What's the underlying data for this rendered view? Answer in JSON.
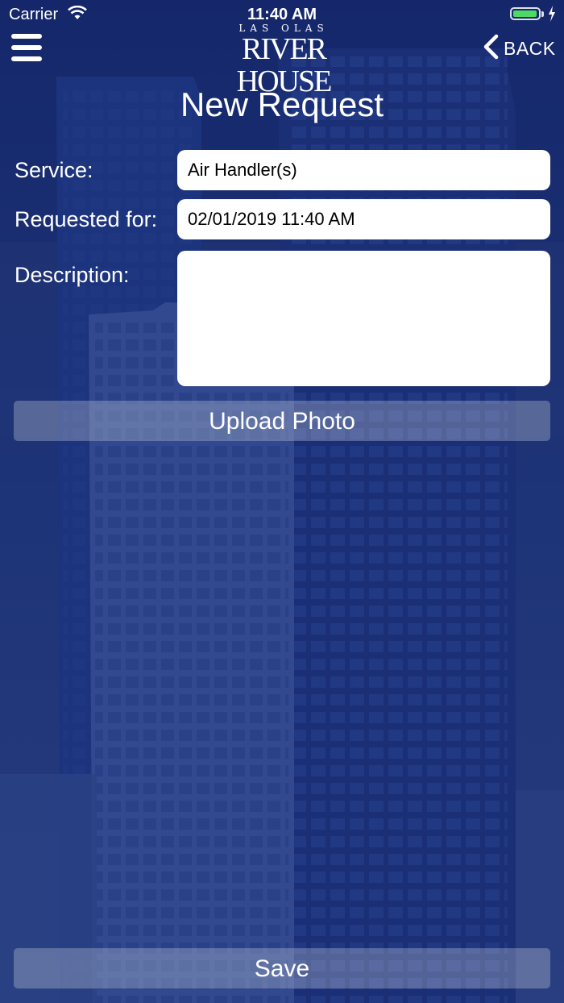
{
  "status_bar": {
    "carrier": "Carrier",
    "time": "11:40 AM",
    "battery_level": 0.95,
    "battery_color": "#4cd964"
  },
  "nav": {
    "menu_icon": "hamburger-menu-icon",
    "logo_top": "LAS OLAS",
    "logo_main": "RIVER HOUSE",
    "back_label": "BACK"
  },
  "page": {
    "title": "New Request"
  },
  "form": {
    "service_label": "Service:",
    "service_value": "Air Handler(s)",
    "requested_for_label": "Requested for:",
    "requested_for_value": "02/01/2019 11:40 AM",
    "description_label": "Description:",
    "description_value": ""
  },
  "buttons": {
    "upload_photo": "Upload Photo",
    "save": "Save"
  },
  "colors": {
    "background": "#1c3372",
    "button_fill": "rgba(205,210,225,0.32)"
  }
}
